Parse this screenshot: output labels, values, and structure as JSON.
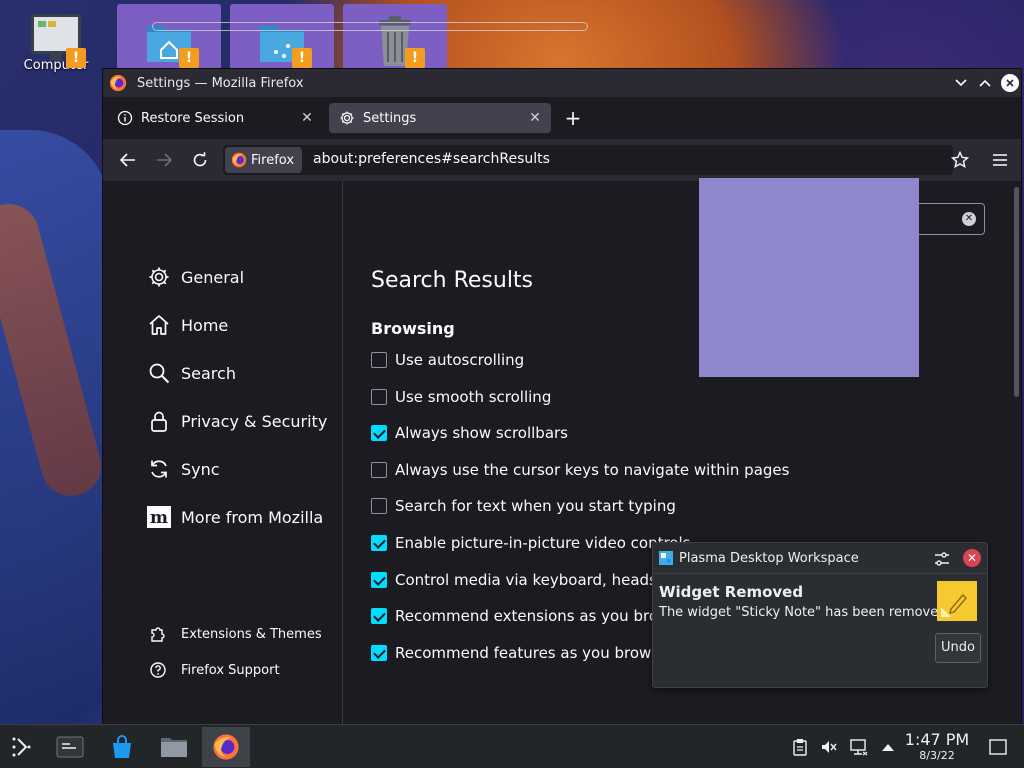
{
  "desktop": {
    "icons": [
      {
        "label": "Computer"
      }
    ],
    "warn_mark": "!"
  },
  "window": {
    "title": "Settings — Mozilla Firefox",
    "tabs": [
      {
        "label": "Restore Session",
        "active": false
      },
      {
        "label": "Settings",
        "active": true
      }
    ],
    "navbar": {
      "identity_label": "Firefox",
      "url": "about:preferences#searchResults"
    }
  },
  "sidebar": {
    "items": [
      {
        "label": "General",
        "icon": "gear-icon"
      },
      {
        "label": "Home",
        "icon": "home-icon"
      },
      {
        "label": "Search",
        "icon": "search-icon"
      },
      {
        "label": "Privacy & Security",
        "icon": "lock-icon"
      },
      {
        "label": "Sync",
        "icon": "sync-icon"
      },
      {
        "label": "More from Mozilla",
        "icon": "mozilla-icon"
      }
    ],
    "footer": [
      {
        "label": "Extensions & Themes",
        "icon": "puzzle-icon"
      },
      {
        "label": "Firefox Support",
        "icon": "help-icon"
      }
    ]
  },
  "main": {
    "title": "Search Results",
    "section": "Browsing",
    "options": [
      {
        "checked": false,
        "parts": [
          "Use autoscrolling"
        ]
      },
      {
        "checked": false,
        "parts": [
          "Use smooth scrolling"
        ]
      },
      {
        "checked": true,
        "parts": [
          "Always show scrollbars"
        ]
      },
      {
        "checked": false,
        "parts": [
          "Always use the cursor keys to navigate within pages"
        ]
      },
      {
        "checked": false,
        "parts": [
          "Search for text when you start typing"
        ]
      },
      {
        "checked": true,
        "parts": [
          "Enable picture-in-picture video controls"
        ]
      },
      {
        "checked": true,
        "parts": [
          "Control media via keyboard, headset, or virtual interface"
        ]
      },
      {
        "checked": true,
        "parts": [
          "Recommend extensions as you browse"
        ]
      },
      {
        "checked": true,
        "parts": [
          "Recommend features as you browse"
        ]
      }
    ]
  },
  "notification": {
    "app": "Plasma Desktop Workspace",
    "title": "Widget Removed",
    "body": "The widget \"Sticky Note\" has been removed.",
    "action": "Undo"
  },
  "taskbar": {
    "time": "1:47 PM",
    "date": "8/3/22"
  },
  "colors": {
    "accent": "#00ddff",
    "highlight": "#0b3ea8",
    "overlay": "#8e87cc",
    "warning": "#f39c1f"
  }
}
